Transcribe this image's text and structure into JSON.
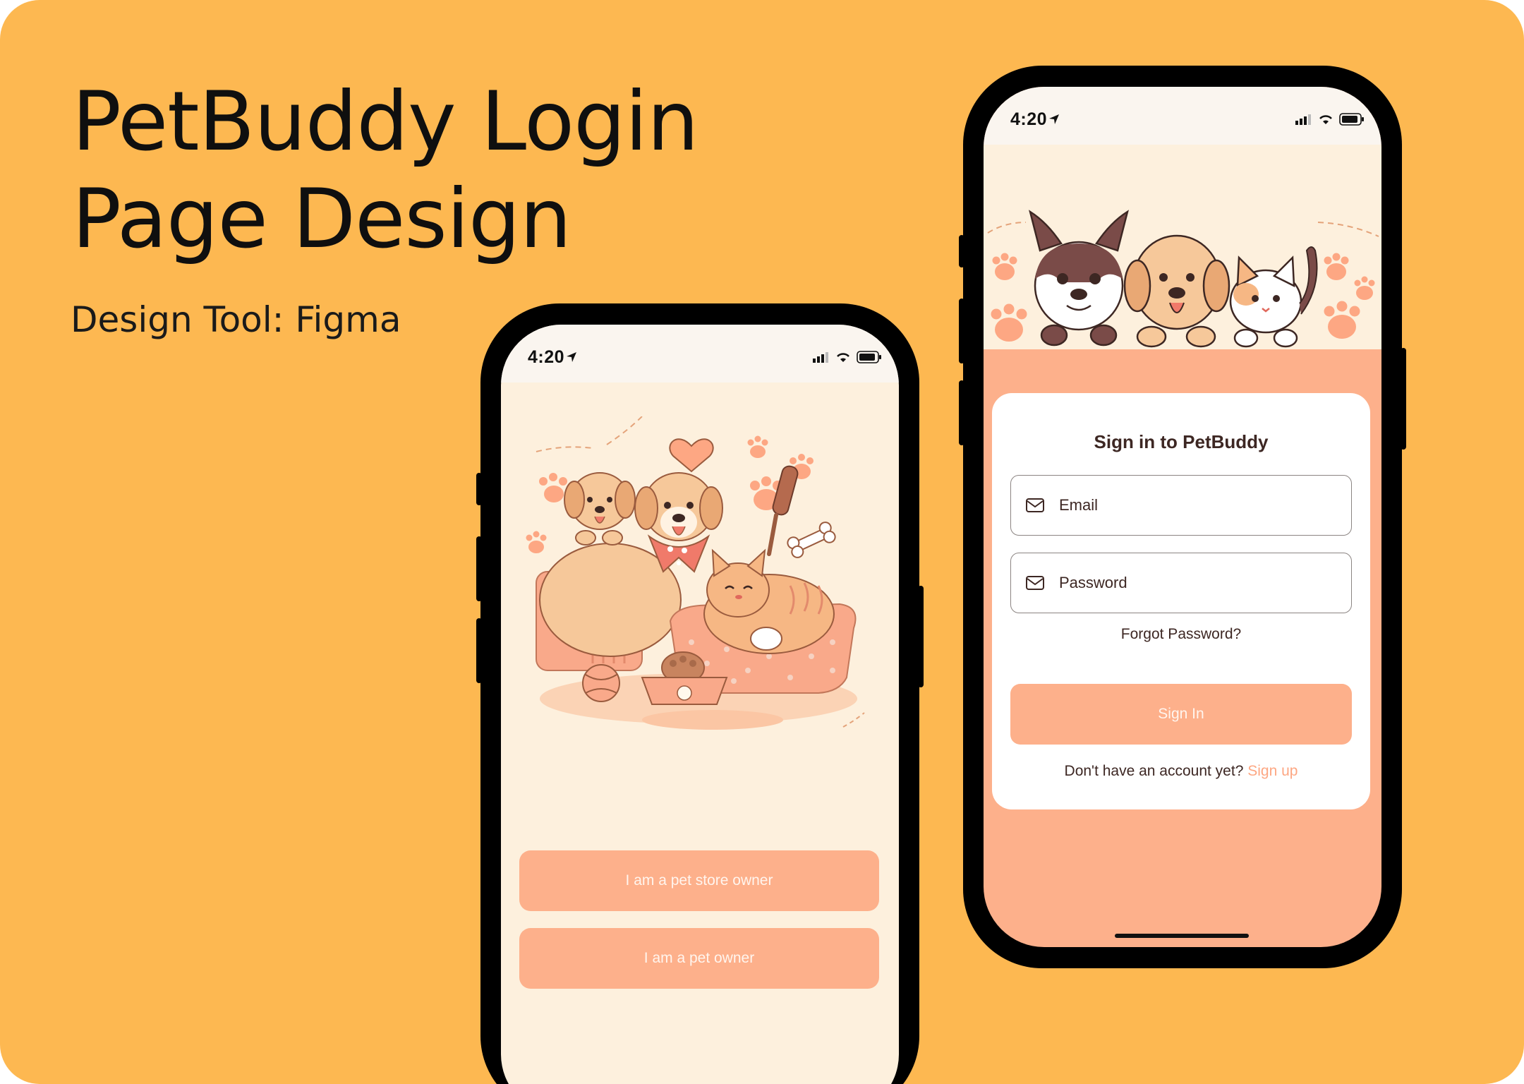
{
  "hero": {
    "title_line1": "PetBuddy Login",
    "title_line2": "Page Design",
    "subtitle": "Design Tool: Figma"
  },
  "status_bar": {
    "time": "4:20",
    "icons": [
      "location-arrow-icon",
      "cellular-signal-icon",
      "wifi-icon",
      "battery-icon"
    ]
  },
  "role_screen": {
    "pet_store_owner_label": "I am a pet store owner",
    "pet_owner_label": "I am a pet owner"
  },
  "signin_screen": {
    "title": "Sign in to PetBuddy",
    "email_placeholder": "Email",
    "password_placeholder": "Password",
    "forgot_label": "Forgot Password?",
    "signin_label": "Sign In",
    "no_account_text": "Don't have an account yet?",
    "signup_label": "Sign up"
  },
  "colors": {
    "background": "#FDB851",
    "accent": "#FDB08B",
    "cream": "#FDF0DD",
    "text_dark": "#3D2723",
    "link": "#FDA783"
  }
}
